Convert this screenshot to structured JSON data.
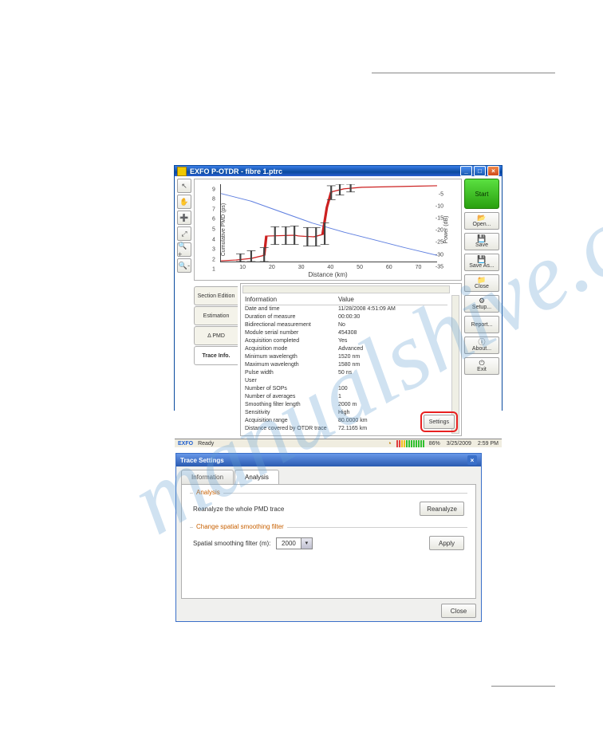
{
  "watermark": "manualshive.com",
  "app": {
    "title": "EXFO P-OTDR - fibre 1.ptrc",
    "tools": [
      "↖",
      "✋",
      "➕",
      "⤢",
      "🔍+",
      "🔍-"
    ],
    "rightButtons": {
      "start": "Start",
      "open": "Open...",
      "save": "Save",
      "saveAs": "Save As...",
      "close": "Close",
      "setup": "Setup...",
      "report": "Report...",
      "about": "About...",
      "exit": "Exit"
    },
    "chart": {
      "xlabel": "Distance (km)",
      "ylabel_left": "Cumulative PMD (ps)",
      "ylabel_right": "Power (dB)",
      "xticks": [
        "10",
        "20",
        "30",
        "40",
        "50",
        "60",
        "70"
      ],
      "yleft": [
        "1",
        "2",
        "3",
        "4",
        "5",
        "6",
        "7",
        "8",
        "9"
      ],
      "yright": [
        "-35",
        "-30",
        "-25",
        "-20",
        "-15",
        "-10",
        "-5"
      ]
    },
    "tabs": {
      "sectionEdition": "Section Edition",
      "estimation": "Estimation",
      "deltaPMD": "Δ PMD",
      "traceInfo": "Trace Info."
    },
    "info": {
      "hInfo": "Information",
      "hVal": "Value",
      "rows": [
        {
          "k": "Date and time",
          "v": "11/28/2008 4:51:09 AM"
        },
        {
          "k": "Duration of measure",
          "v": "00:00:30"
        },
        {
          "k": "Bidirectional measurement",
          "v": "No"
        },
        {
          "k": "Module serial number",
          "v": "454308"
        },
        {
          "k": "Acquisition completed",
          "v": "Yes"
        },
        {
          "k": "Acquisition mode",
          "v": "Advanced"
        },
        {
          "k": "Minimum wavelength",
          "v": "1520 nm"
        },
        {
          "k": "Maximum wavelength",
          "v": "1580 nm"
        },
        {
          "k": "Pulse width",
          "v": "50 ns"
        },
        {
          "k": "User",
          "v": ""
        },
        {
          "k": "Number of SOPs",
          "v": "100"
        },
        {
          "k": "Number of averages",
          "v": "1"
        },
        {
          "k": "Smoothing filter length",
          "v": "2000 m"
        },
        {
          "k": "Sensitivity",
          "v": "High"
        },
        {
          "k": "Acquisition range",
          "v": "80.0000 km"
        },
        {
          "k": "Distance covered by OTDR trace",
          "v": "72.1165 km"
        }
      ],
      "settings": "Settings"
    },
    "status": {
      "logo": "EXFO",
      "ready": "Ready",
      "pct": "86%",
      "date": "3/25/2009",
      "time": "2:59 PM"
    }
  },
  "dialog": {
    "title": "Trace Settings",
    "tabs": {
      "information": "Information",
      "analysis": "Analysis"
    },
    "analysisLabel": "Analysis",
    "reanalyzeText": "Reanalyze the whole PMD trace",
    "reanalyzeBtn": "Reanalyze",
    "smoothLabel": "Change spatial smoothing filter",
    "smoothField": "Spatial smoothing filter (m):",
    "smoothValue": "2000",
    "applyBtn": "Apply",
    "closeBtn": "Close"
  },
  "chart_data": {
    "type": "line",
    "xlabel": "Distance (km)",
    "ylabel_left": "Cumulative PMD (ps)",
    "ylabel_right": "Power (dB)",
    "xlim": [
      0,
      70
    ],
    "ylim_left": [
      0,
      9
    ],
    "ylim_right": [
      -40,
      0
    ],
    "series": [
      {
        "name": "Cumulative PMD",
        "axis": "left",
        "color": "#cc2020",
        "x": [
          0,
          5,
          10,
          14,
          15,
          24,
          25,
          30,
          34,
          35,
          36,
          40,
          46,
          70
        ],
        "y": [
          0,
          0.2,
          0.6,
          1.0,
          3.0,
          3.2,
          3.1,
          3.0,
          3.3,
          6.5,
          8.2,
          8.6,
          8.8,
          8.9
        ]
      },
      {
        "name": "Power",
        "axis": "right",
        "color": "#6080e0",
        "x": [
          0,
          10,
          20,
          30,
          40,
          50,
          60,
          70
        ],
        "y": [
          -4,
          -8,
          -13,
          -18,
          -22,
          -26,
          -30,
          -34
        ]
      }
    ],
    "error_bars": {
      "on_series": "Cumulative PMD",
      "x": [
        6,
        10,
        14,
        18,
        22,
        24,
        28,
        31,
        34,
        36,
        38,
        42
      ],
      "delta": 0.8
    }
  }
}
